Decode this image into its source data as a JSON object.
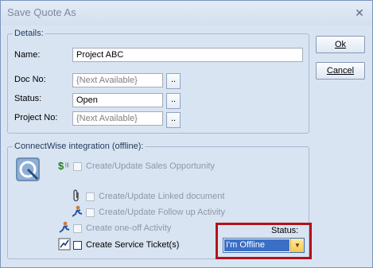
{
  "window": {
    "title": "Save Quote As",
    "close_glyph": "✕"
  },
  "details": {
    "legend": "Details:",
    "name_label": "Name:",
    "name_value": "Project ABC",
    "docno_label": "Doc No:",
    "docno_value": "{Next Available}",
    "status_label": "Status:",
    "status_value": "Open",
    "projectno_label": "Project No:",
    "projectno_value": "{Next Available}",
    "ellipsis": ".."
  },
  "buttons": {
    "ok": "Ok",
    "cancel": "Cancel"
  },
  "connectwise": {
    "legend": "ConnectWise integration (offline):",
    "logo_icon": "connectwise-logo",
    "options": [
      {
        "label": "Create/Update Sales Opportunity",
        "icon": "dollar-icon",
        "enabled": false,
        "checked": false
      },
      {
        "label": "Create/Update Linked document",
        "icon": "paperclip-icon",
        "enabled": false,
        "checked": false
      },
      {
        "label": "Create/Update Follow up Activity",
        "icon": "person-run-icon",
        "enabled": false,
        "checked": false
      },
      {
        "label": "Create one-off Activity",
        "icon": "person-run-icon",
        "enabled": false,
        "checked": false
      },
      {
        "label": "Create Service Ticket(s)",
        "icon": "ticket-icon",
        "enabled": true,
        "checked": false
      }
    ],
    "status_label": "Status:",
    "status_value": "I'm Offline"
  },
  "colors": {
    "highlight": "#b4121b",
    "selection": "#3a6fc5"
  }
}
